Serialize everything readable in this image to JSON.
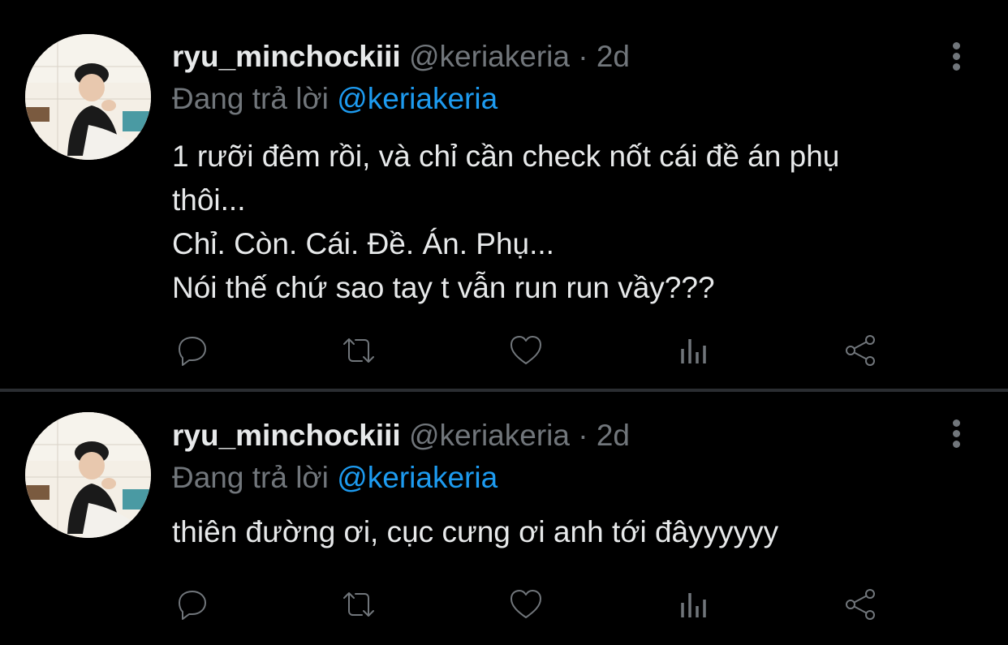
{
  "tweets": [
    {
      "display_name": "ryu_minchockiii",
      "handle": "@keriakeria",
      "separator": "·",
      "time": "2d",
      "reply_prefix": "Đang trả lời",
      "reply_to": "@keriakeria",
      "lines": [
        "1 rưỡi đêm rồi, và chỉ cần check nốt cái đề án phụ",
        "thôi...",
        "Chỉ. Còn. Cái. Đề. Án. Phụ...",
        "Nói thế chứ sao tay t vẫn run run vầy???"
      ]
    },
    {
      "display_name": "ryu_minchockiii",
      "handle": "@keriakeria",
      "separator": "·",
      "time": "2d",
      "reply_prefix": "Đang trả lời",
      "reply_to": "@keriakeria",
      "lines": [
        "thiên đường ơi, cục cưng ơi anh tới đâyyyyyy"
      ]
    }
  ],
  "icons": {
    "reply": "reply-icon",
    "retweet": "retweet-icon",
    "like": "heart-icon",
    "analytics": "analytics-icon",
    "share": "share-icon",
    "more": "more-vertical-icon"
  },
  "colors": {
    "background": "#000000",
    "text": "#e7e9ea",
    "secondary": "#71767b",
    "mention": "#1d9bf0"
  }
}
